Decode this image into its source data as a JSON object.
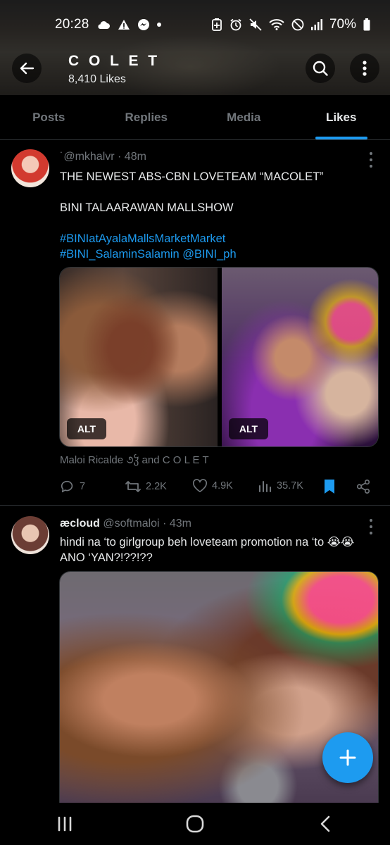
{
  "status_bar": {
    "time": "20:28",
    "battery": "70%",
    "left_icons": [
      "cloud-icon",
      "warning-icon",
      "messenger-icon",
      "dot-icon"
    ],
    "right_icons": [
      "battery-saver-icon",
      "alarm-icon",
      "mute-icon",
      "wifi-icon",
      "do-not-disturb-icon",
      "signal-icon",
      "battery-icon"
    ]
  },
  "header": {
    "title": "C O L E T",
    "likes_count": "8,410 Likes"
  },
  "tabs": [
    {
      "label": "Posts",
      "active": false
    },
    {
      "label": "Replies",
      "active": false
    },
    {
      "label": "Media",
      "active": false
    },
    {
      "label": "Likes",
      "active": true
    }
  ],
  "tweets": [
    {
      "display_name": "",
      "handle": "˙@mkhalvr",
      "time": "· 48m",
      "line1": "THE NEWEST ABS-CBN LOVETEAM “MACOLET”",
      "line2": "BINI TALAARAWAN MALLSHOW",
      "hashtag1": "#BINIatAyalaMallsMarketMarket",
      "hashtag2": "#BINI_SalaminSalamin",
      "mention": "@BINI_ph",
      "media_alt": [
        "ALT",
        "ALT"
      ],
      "liked_by": "Maloi Ricalde ૭ჴ and C O L E T",
      "replies": "7",
      "reposts": "2.2K",
      "likes": "4.9K",
      "views": "35.7K"
    },
    {
      "display_name": "æcloud",
      "handle": "@softmaloi",
      "time": "· 43m",
      "line1": "hindi na ‘to girlgroup beh loveteam promotion na ‘to 😭😭",
      "line2": "ANO ‘YAN?!??!??"
    }
  ],
  "colors": {
    "accent": "#1d9bf0",
    "muted": "#71767b",
    "text": "#e7e9ea",
    "background": "#000000"
  }
}
